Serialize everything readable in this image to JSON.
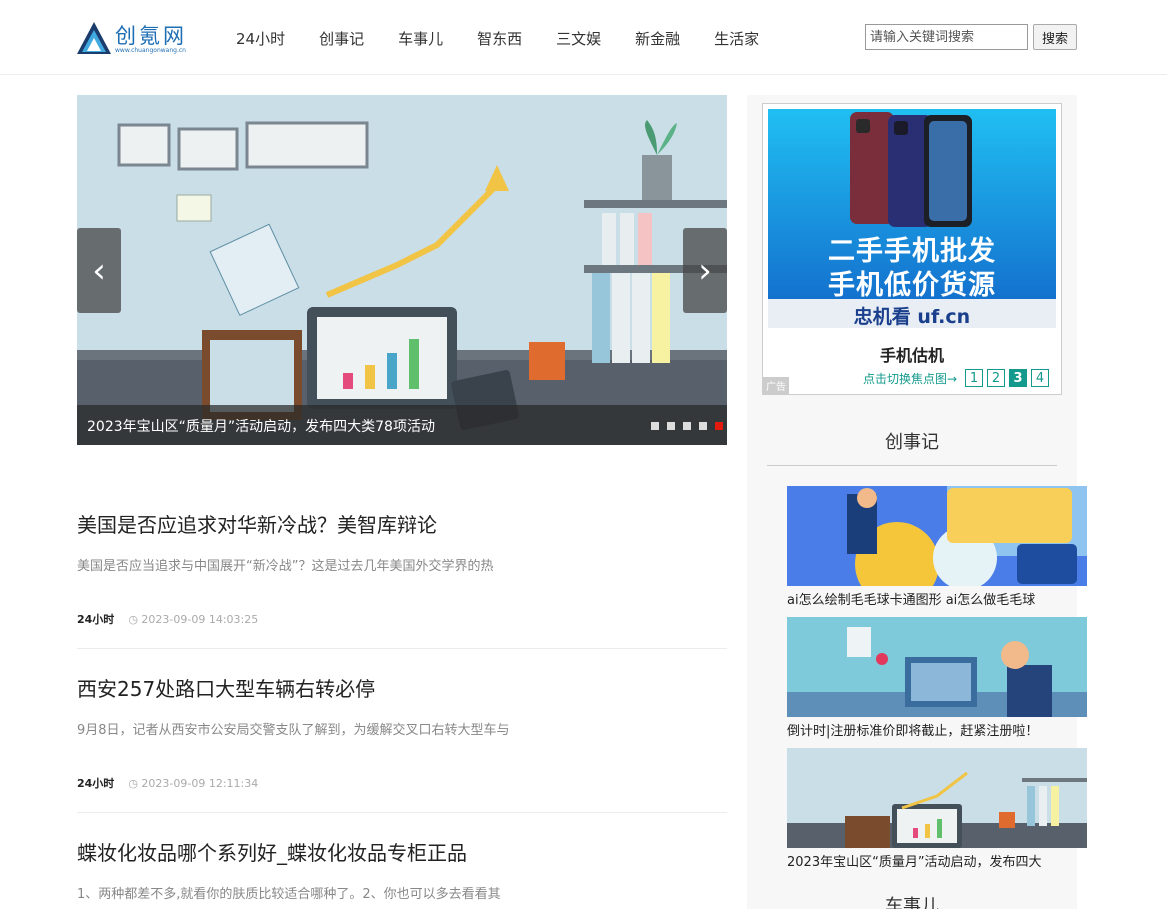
{
  "header": {
    "logo_text": "创氪网",
    "logo_domain": "www.chuangonwang.cn",
    "nav": [
      "24小时",
      "创事记",
      "车事儿",
      "智东西",
      "三文娱",
      "新金融",
      "生活家"
    ],
    "search_placeholder": "请输入关键词搜索",
    "search_button": "搜索"
  },
  "slider": {
    "caption": "2023年宝山区“质量月”活动启动，发布四大类78项活动",
    "prev_icon": "chevron-left-icon",
    "next_icon": "chevron-right-icon",
    "prev_glyph": "‹",
    "next_glyph": "›",
    "dots_total": 5,
    "active_dot": 5
  },
  "articles": [
    {
      "title": "美国是否应追求对华新冷战？美智库辩论",
      "summary": "美国是否应当追求与中国展开“新冷战”？这是过去几年美国外交学界的热",
      "category": "24小时",
      "time": "2023-09-09 14:03:25"
    },
    {
      "title": "西安257处路口大型车辆右转必停",
      "summary": "9月8日，记者从西安市公安局交警支队了解到，为缓解交叉口右转大型车与",
      "category": "24小时",
      "time": "2023-09-09 12:11:34"
    },
    {
      "title": "蝶妆化妆品哪个系列好_蝶妆化妆品专柜正品",
      "summary": "1、两种都差不多,就看你的肤质比较适合哪种了。2、你也可以多去看看其",
      "category": "",
      "time": ""
    }
  ],
  "sidebar": {
    "ad": {
      "banner_line1": "二手手机批发",
      "banner_line2": "手机低价货源",
      "banner_brand": "忠机看 uf.cn",
      "title": "手机估机",
      "tag": "广告",
      "switch_text": "点击切换焦点图→",
      "pages": [
        "1",
        "2",
        "3",
        "4"
      ],
      "active_page": "3"
    },
    "section1_title": "创事记",
    "items": [
      {
        "caption": "ai怎么绘制毛毛球卡通图形 ai怎么做毛毛球"
      },
      {
        "caption": "倒计时|注册标准价即将截止，赶紧注册啦！"
      },
      {
        "caption": "2023年宝山区“质量月”活动启动，发布四大"
      }
    ],
    "section2_title": "车事儿"
  },
  "colors": {
    "accent_teal": "#139a8d",
    "logo_blue": "#1e6eb4",
    "dot_active": "#e31b0e"
  }
}
